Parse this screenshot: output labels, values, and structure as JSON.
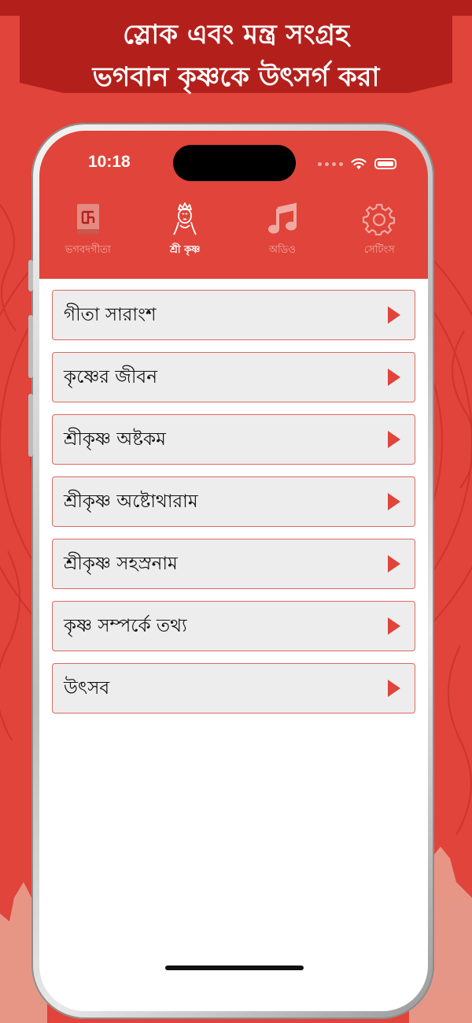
{
  "banner": {
    "line1": "স্লোক এবং মন্ত্র সংগ্রহ",
    "line2": "ভগবান কৃষ্ণকে উৎসর্গ করা"
  },
  "status": {
    "time": "10:18"
  },
  "tabs": [
    {
      "label": "ভগবদগীতা",
      "icon": "book-swastika-icon",
      "active": false
    },
    {
      "label": "শ্রী কৃষ্ণ",
      "icon": "krishna-icon",
      "active": true
    },
    {
      "label": "অডিও",
      "icon": "music-note-icon",
      "active": false
    },
    {
      "label": "সেটিংস",
      "icon": "gear-icon",
      "active": false
    }
  ],
  "list": [
    {
      "label": "গীতা সারাংশ"
    },
    {
      "label": "কৃষ্ণের জীবন"
    },
    {
      "label": "শ্রীকৃষ্ণ অষ্টকম"
    },
    {
      "label": "শ্রীকৃষ্ণ অষ্টোথারাম"
    },
    {
      "label": "শ্রীকৃষ্ণ সহস্রনাম"
    },
    {
      "label": "কৃষ্ণ সম্পর্কে তথ্য"
    },
    {
      "label": "উৎসব"
    }
  ],
  "colors": {
    "primary": "#e0443a",
    "banner": "#b3201c",
    "row_bg": "#ededed",
    "row_border": "#d96b60"
  }
}
